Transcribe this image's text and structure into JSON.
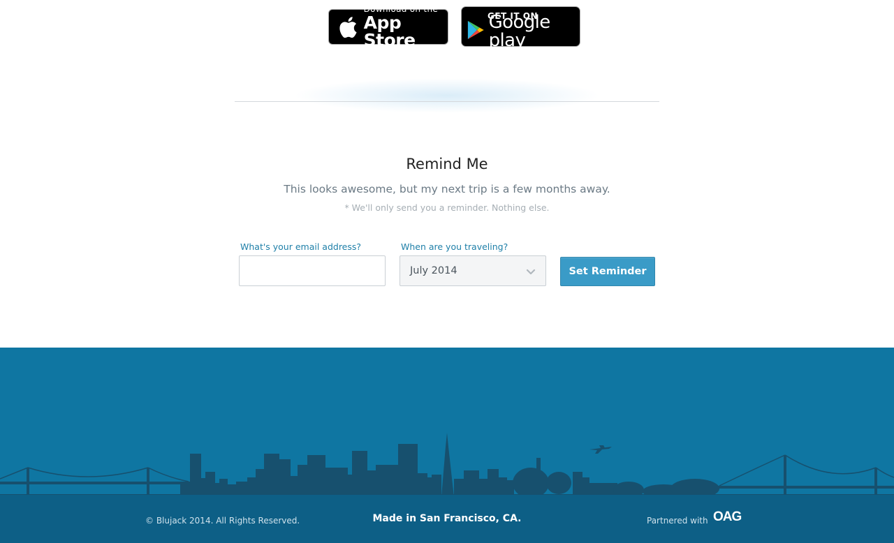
{
  "store_badges": {
    "app_store": {
      "small": "Download on the",
      "big": "App Store"
    },
    "google_play": {
      "small": "GET IT ON",
      "big": "Google play"
    }
  },
  "remind": {
    "title": "Remind Me",
    "subtitle": "This looks awesome, but my next trip is a few months away.",
    "note": "* We'll only send you a reminder. Nothing else.",
    "email_label": "What's your email address?",
    "email_value": "",
    "email_placeholder": "",
    "travel_label": "When are you traveling?",
    "travel_value": "July 2014",
    "button_label": "Set Reminder"
  },
  "footer": {
    "copyright": "© Blujack 2014. All Rights Reserved.",
    "made_in": "Made in San Francisco, CA.",
    "partnered_with": "Partnered with",
    "partner_logo": "OAG"
  },
  "colors": {
    "accent": "#1e7fa8",
    "button": "#3a9bc7",
    "footer_top": "#0f76a2",
    "footer_bottom": "#0d5f86",
    "skyline": "#17506e"
  },
  "icons": [
    "apple-icon",
    "google-play-icon",
    "chevron-down-icon",
    "airplane-icon"
  ]
}
